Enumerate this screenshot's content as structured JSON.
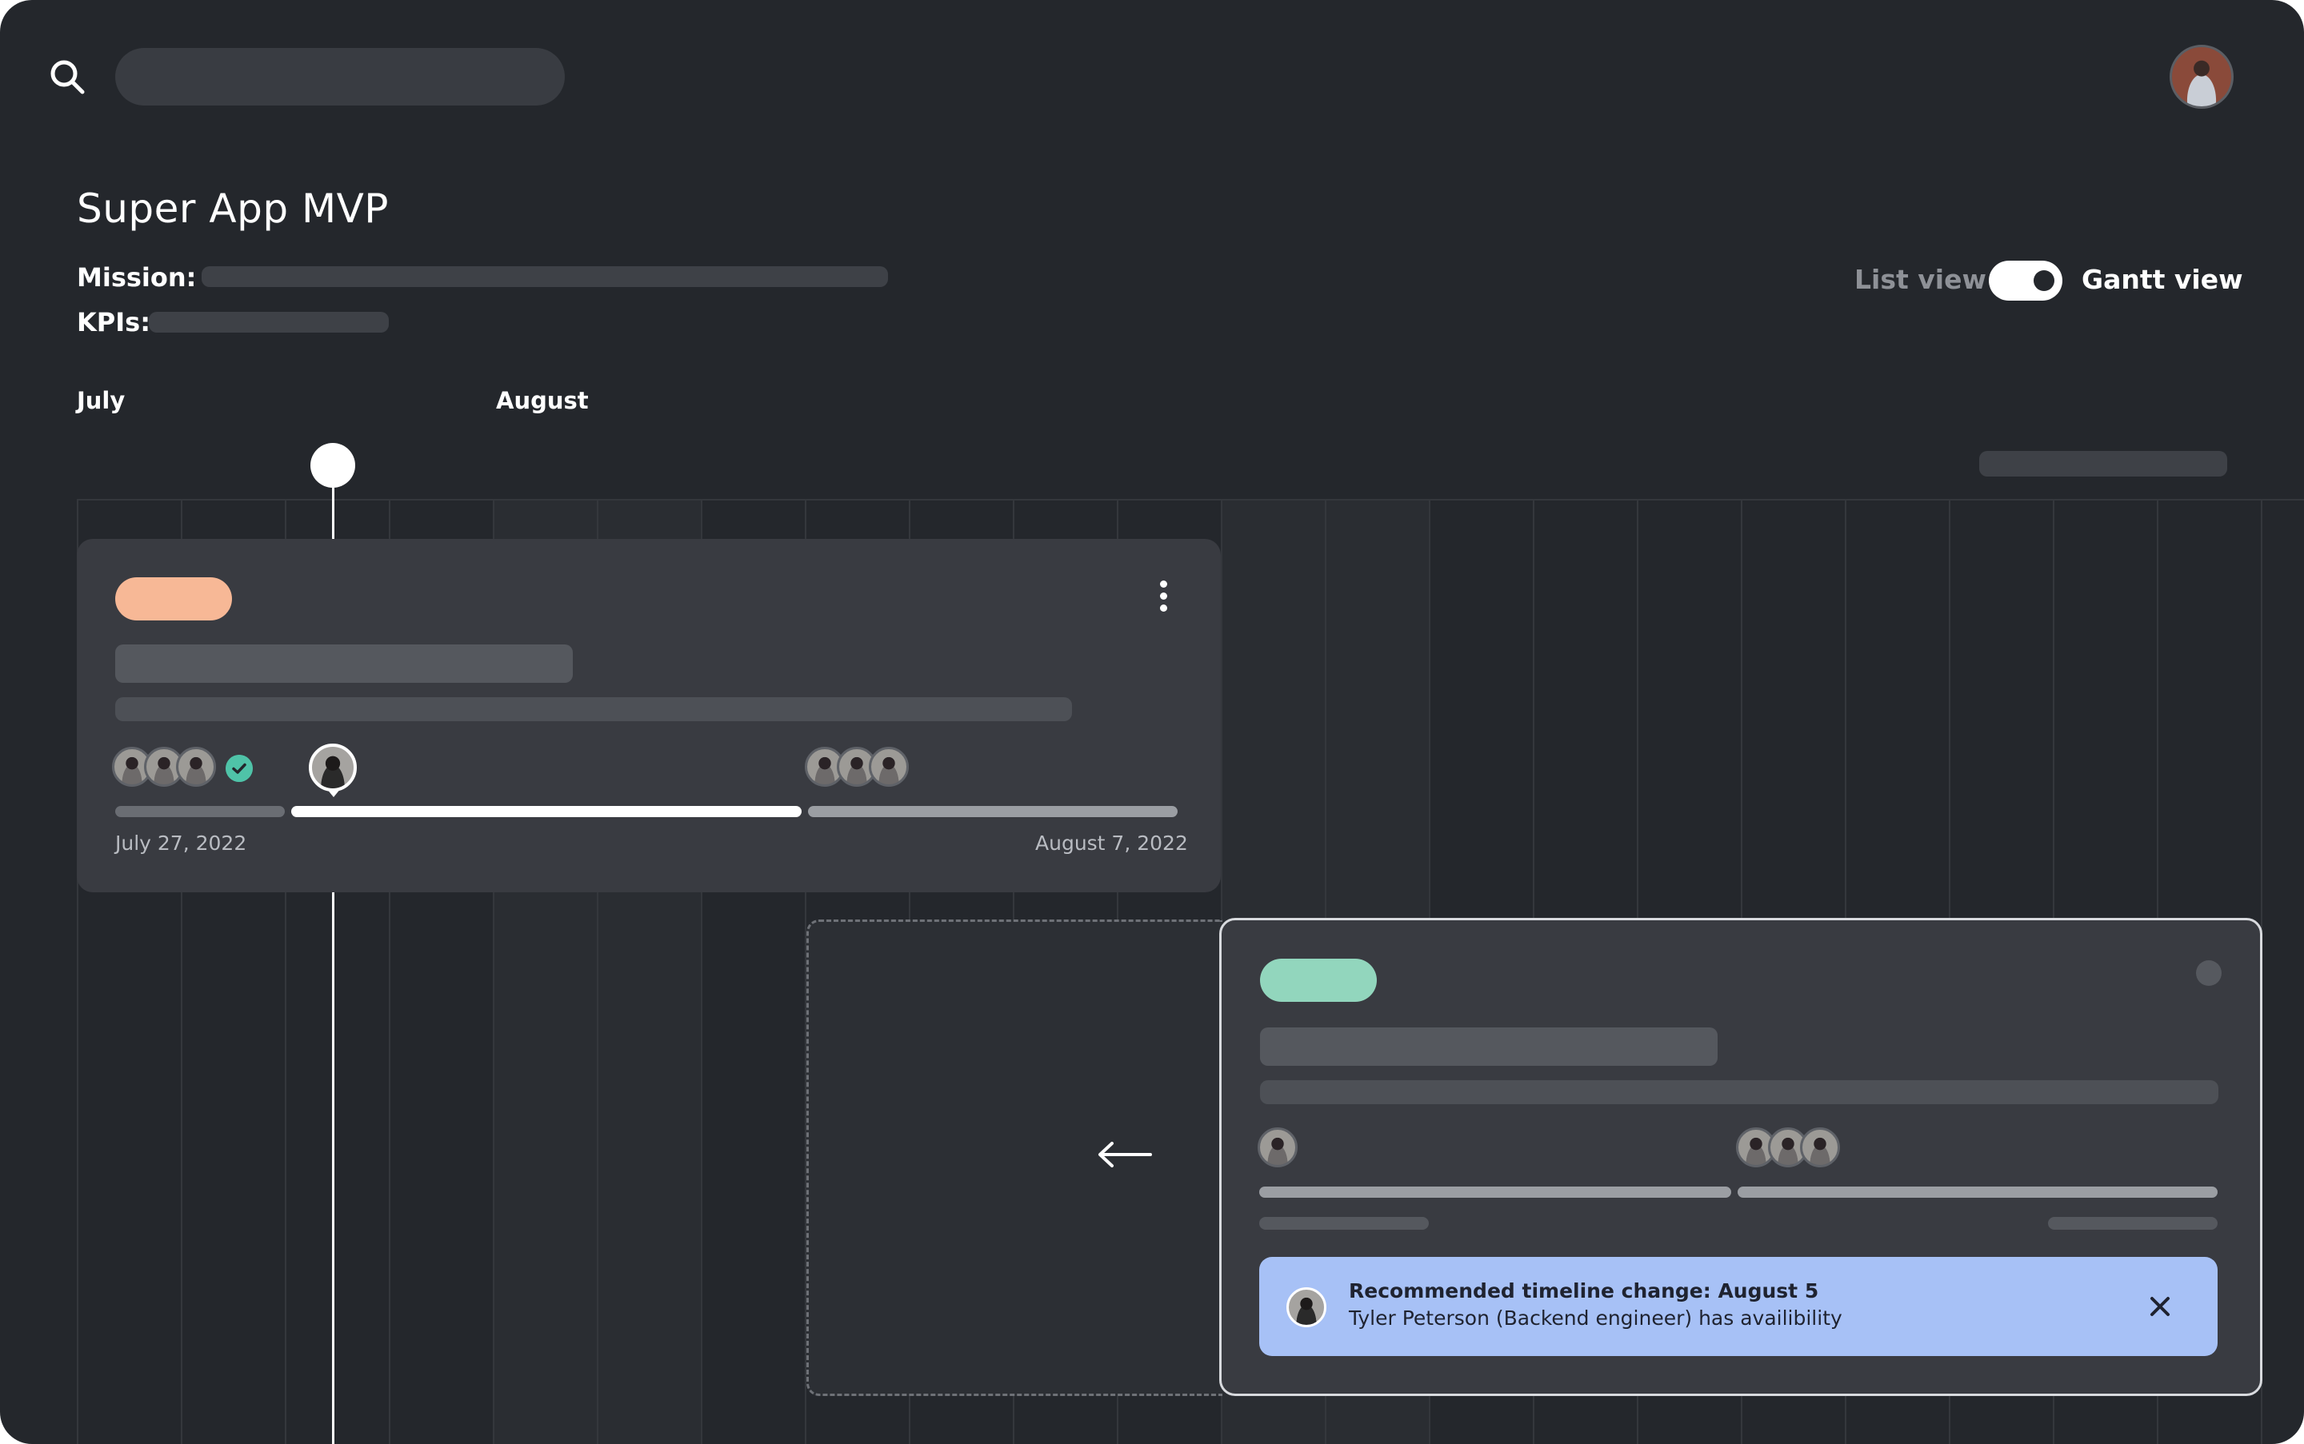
{
  "header": {
    "title": "Super App MVP",
    "mission_label": "Mission:",
    "kpis_label": "KPIs:"
  },
  "view_toggle": {
    "left_label": "List view",
    "right_label": "Gantt view",
    "active": "Gantt view"
  },
  "timeline": {
    "months": [
      "July",
      "August"
    ]
  },
  "cards": [
    {
      "tag_color": "#f7b896",
      "start_date": "July 27, 2022",
      "end_date": "August 7, 2022"
    },
    {
      "tag_color": "#92d6bd"
    }
  ],
  "notice": {
    "title": "Recommended timeline change: August 5",
    "text": "Tyler Peterson (Backend engineer) has availibility"
  },
  "icons": {
    "search": "search-icon",
    "more": "more-vertical-icon",
    "check": "check-circle-icon",
    "arrow": "arrow-left-icon",
    "close": "close-icon"
  },
  "colors": {
    "background": "#24272c",
    "card": "#393b41",
    "accent_peach": "#f7b896",
    "accent_mint": "#92d6bd",
    "notice_bg": "#a7c1f6",
    "check": "#4fc3a8"
  }
}
